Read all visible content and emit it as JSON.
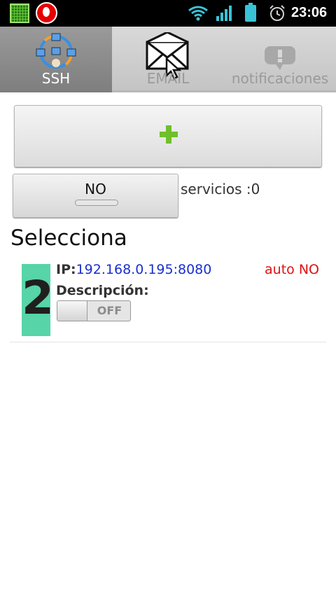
{
  "status_bar": {
    "time": "23:06",
    "icons": [
      "app-grid-icon",
      "vodafone-icon",
      "wifi-icon",
      "signal-icon",
      "battery-icon",
      "alarm-icon"
    ]
  },
  "tabs": [
    {
      "label": "SSH",
      "icon": "network-icon",
      "selected": true
    },
    {
      "label": "EMAIL",
      "icon": "envelope-icon",
      "selected": false
    },
    {
      "label": "notificaciones",
      "icon": "notification-bubble-icon",
      "selected": false
    }
  ],
  "add_button": {
    "icon": "plus-icon"
  },
  "toggle_button": {
    "label": "NO"
  },
  "services_text": "servicios :0",
  "heading": "Selecciona",
  "items": [
    {
      "number": "2",
      "ip_key": "IP:",
      "ip_value": "192.168.0.195:8080",
      "auto_text": "auto NO",
      "description_label": "Descripción:",
      "switch_label": "OFF"
    }
  ],
  "colors": {
    "accent_green": "#57d4a8",
    "plus_green": "#6fbf2a",
    "ip_blue": "#1a2fd0",
    "auto_red": "#e01010",
    "battery_cyan": "#39c3d7"
  }
}
